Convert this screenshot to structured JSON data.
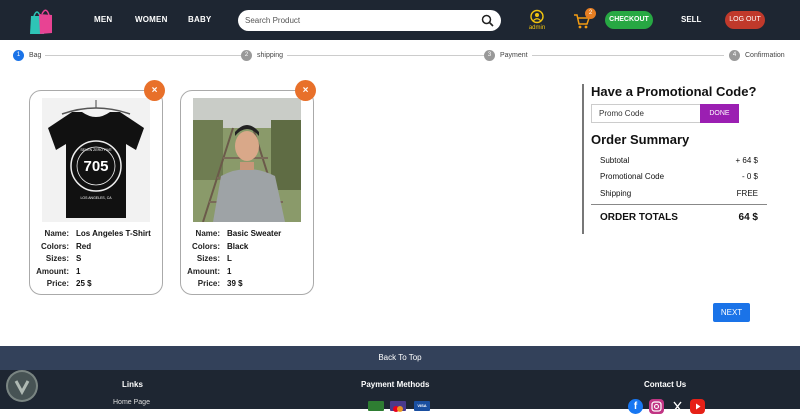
{
  "header": {
    "nav": [
      "MEN",
      "WOMEN",
      "BABY"
    ],
    "search_placeholder": "Search Product",
    "user_label": "admin",
    "cart_count": "2",
    "checkout_label": "CHECKOUT",
    "sell_label": "SELL",
    "logout_label": "LOG OUT"
  },
  "steps": [
    {
      "num": "1",
      "label": "Bag"
    },
    {
      "num": "2",
      "label": "shipping"
    },
    {
      "num": "3",
      "label": "Payment"
    },
    {
      "num": "4",
      "label": "Confirmation"
    }
  ],
  "cart_items": [
    {
      "name_label": "Name:",
      "name": "Los Angeles T-Shirt",
      "colors_label": "Colors:",
      "color": "Red",
      "sizes_label": "Sizes:",
      "size": "S",
      "amount_label": "Amount:",
      "amount": "1",
      "price_label": "Price:",
      "price": "25 $",
      "remove": "×",
      "shirt_text_top": "SEVEN ZERO FIVE",
      "shirt_number": "705",
      "shirt_text_city": "LOS ANGELES, CA"
    },
    {
      "name_label": "Name:",
      "name": "Basic Sweater",
      "colors_label": "Colors:",
      "color": "Black",
      "sizes_label": "Sizes:",
      "size": "L",
      "amount_label": "Amount:",
      "amount": "1",
      "price_label": "Price:",
      "price": "39 $",
      "remove": "×"
    }
  ],
  "promo": {
    "title": "Have a Promotional Code?",
    "placeholder": "Promo Code",
    "button": "DONE"
  },
  "summary": {
    "title": "Order Summary",
    "rows": [
      {
        "label": "Subtotal",
        "value": "+ 64 $"
      },
      {
        "label": "Promotional Code",
        "value": "- 0 $"
      },
      {
        "label": "Shipping",
        "value": "FREE"
      }
    ],
    "total_label": "ORDER TOTALS",
    "total_value": "64 $"
  },
  "next_label": "NEXT",
  "footer": {
    "back_to_top": "Back To Top",
    "links_title": "Links",
    "home_link": "Home Page",
    "payment_title": "Payment Methods",
    "payment_card_label": "VISA",
    "contact_title": "Contact Us"
  },
  "colors": {
    "topbar": "#1e2632",
    "checkout": "#27a843",
    "logout": "#c0392b",
    "done": "#9b1fb2",
    "next": "#1a73e8",
    "remove": "#e8702a",
    "cart_badge": "#e67e22",
    "back_to_top": "#33415a"
  }
}
